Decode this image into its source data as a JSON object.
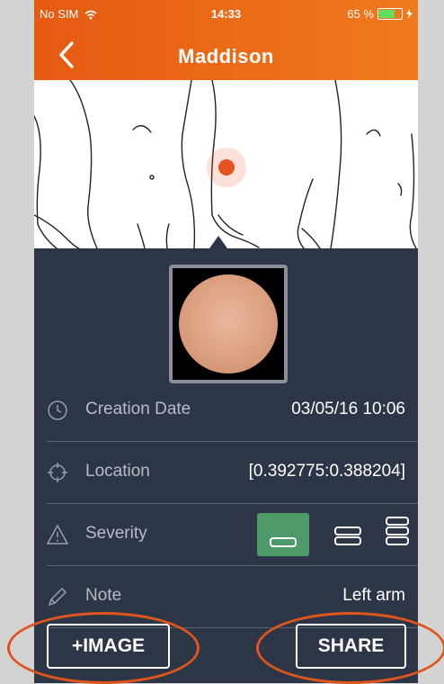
{
  "status_bar": {
    "carrier": "No SIM",
    "time": "14:33",
    "battery": "65 %"
  },
  "header": {
    "title": "Maddison"
  },
  "details": {
    "creation_date_label": "Creation Date",
    "creation_date_value": "03/05/16 10:06",
    "location_label": "Location",
    "location_value": "[0.392775:0.388204]",
    "severity_label": "Severity",
    "note_label": "Note",
    "note_value": "Left arm"
  },
  "actions": {
    "add_image": "+IMAGE",
    "share": "SHARE"
  },
  "colors": {
    "header": "#ea6a18",
    "panel": "#2d3646",
    "accent_green": "#4f9a6b",
    "marker": "#e55420"
  }
}
